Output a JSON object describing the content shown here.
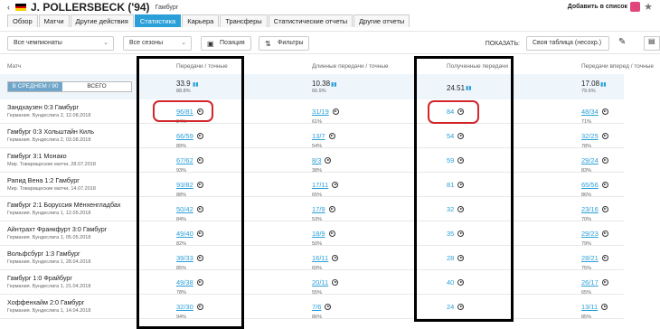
{
  "header": {
    "back": "‹",
    "flag_colors": [
      "#000000",
      "#dd0000",
      "#ffce00"
    ],
    "player": "J. POLLERSBECK ('94)",
    "club": "Гамбург",
    "add_to_list": "Добавить в список",
    "star": "★"
  },
  "tabs": [
    "Обзор",
    "Матчи",
    "Другие действия",
    "Статистика",
    "Карьера",
    "Трансферы",
    "Статистические отчеты",
    "Другие отчеты"
  ],
  "filters": {
    "championships": "Все чемпионаты",
    "seasons": "Все сезоны",
    "position": "Позиция",
    "filters": "Фильтры",
    "show_label": "ПОКАЗАТЬ:",
    "show_value": "Своя таблица (несохр.)"
  },
  "columns": {
    "match": "Матч",
    "passes": "Передачи / точные",
    "long": "Длинные передачи / точные",
    "received": "Полученные передачи",
    "forward": "Передачи вперед / точные"
  },
  "average": {
    "avg_label": "В СРЕДНЕМ / 90",
    "total_label": "ВСЕГО",
    "passes": "33.9",
    "passes_pct": "88.8%",
    "long": "10.38",
    "long_pct": "66.9%",
    "received": "24.51",
    "forward": "17.08",
    "forward_pct": "79.6%"
  },
  "rows": [
    {
      "match": "Зандхаузен 0:3 Гамбург",
      "sub": "Германия. Бундеслига 2, 12.08.2018",
      "passes": "96/81",
      "passes_pct": "84%",
      "long": "31/19",
      "long_pct": "61%",
      "received": "84",
      "forward": "48/34",
      "forward_pct": "71%"
    },
    {
      "match": "Гамбург 0:3 Хольштайн Киль",
      "sub": "Германия. Бундеслига 2, 03.08.2018",
      "passes": "66/59",
      "passes_pct": "89%",
      "long": "13/7",
      "long_pct": "54%",
      "received": "54",
      "forward": "32/25",
      "forward_pct": "78%"
    },
    {
      "match": "Гамбург 3:1 Монако",
      "sub": "Мир. Товарищеские матчи, 28.07.2018",
      "passes": "67/62",
      "passes_pct": "93%",
      "long": "8/3",
      "long_pct": "38%",
      "received": "59",
      "forward": "29/24",
      "forward_pct": "83%"
    },
    {
      "match": "Рапид Вена 1:2 Гамбург",
      "sub": "Мир. Товарищеские матчи, 14.07.2018",
      "passes": "93/82",
      "passes_pct": "88%",
      "long": "17/11",
      "long_pct": "65%",
      "received": "81",
      "forward": "65/56",
      "forward_pct": "86%"
    },
    {
      "match": "Гамбург 2:1 Боруссия Мёнхенгладбах",
      "sub": "Германия. Бундеслига 1, 12.05.2018",
      "passes": "50/42",
      "passes_pct": "84%",
      "long": "17/9",
      "long_pct": "53%",
      "received": "32",
      "forward": "23/16",
      "forward_pct": "70%"
    },
    {
      "match": "Айнтрахт Франкфурт 3:0 Гамбург",
      "sub": "Германия. Бундеслига 1, 05.05.2018",
      "passes": "49/40",
      "passes_pct": "82%",
      "long": "18/9",
      "long_pct": "50%",
      "received": "35",
      "forward": "29/23",
      "forward_pct": "79%"
    },
    {
      "match": "Вольфсбург 1:3 Гамбург",
      "sub": "Германия. Бундеслига 1, 28.04.2018",
      "passes": "39/33",
      "passes_pct": "85%",
      "long": "16/11",
      "long_pct": "69%",
      "received": "28",
      "forward": "28/21",
      "forward_pct": "75%"
    },
    {
      "match": "Гамбург 1:0 Фрайбург",
      "sub": "Германия. Бундеслига 1, 21.04.2018",
      "passes": "49/38",
      "passes_pct": "78%",
      "long": "20/11",
      "long_pct": "55%",
      "received": "40",
      "forward": "26/17",
      "forward_pct": "65%"
    },
    {
      "match": "Хоффенхайм 2:0 Гамбург",
      "sub": "Германия. Бундеслига 1, 14.04.2018",
      "passes": "32/30",
      "passes_pct": "94%",
      "long": "7/6",
      "long_pct": "86%",
      "received": "24",
      "forward": "13/11",
      "forward_pct": "85%"
    }
  ]
}
